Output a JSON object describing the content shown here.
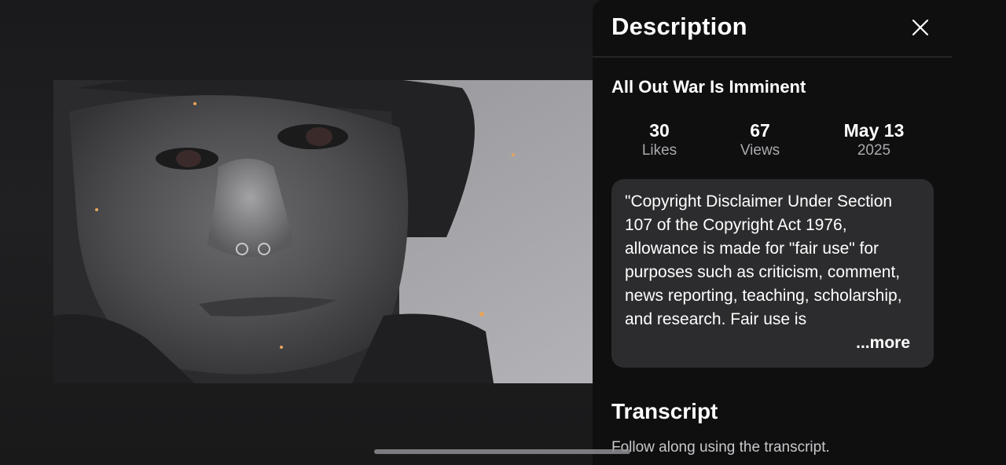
{
  "panel": {
    "header": "Description",
    "close_icon": "close-x-icon",
    "video_title": "All Out War Is Imminent",
    "stats": {
      "likes_value": "30",
      "likes_label": "Likes",
      "views_value": "67",
      "views_label": "Views",
      "date_value": "May 13",
      "date_year": "2025"
    },
    "description_text": "\"Copyright Disclaimer Under Section 107 of the Copyright Act 1976, allowance is made for \"fair use\" for purposes such as criticism, comment, news reporting, teaching, scholarship, and research. Fair use is",
    "more_label": "...more",
    "transcript_title": "Transcript",
    "transcript_subtitle": "Follow along using the transcript."
  },
  "colors": {
    "panel_bg": "#0f0f10",
    "description_box_bg": "#2c2c2e",
    "secondary_text": "#a9a9ad"
  }
}
